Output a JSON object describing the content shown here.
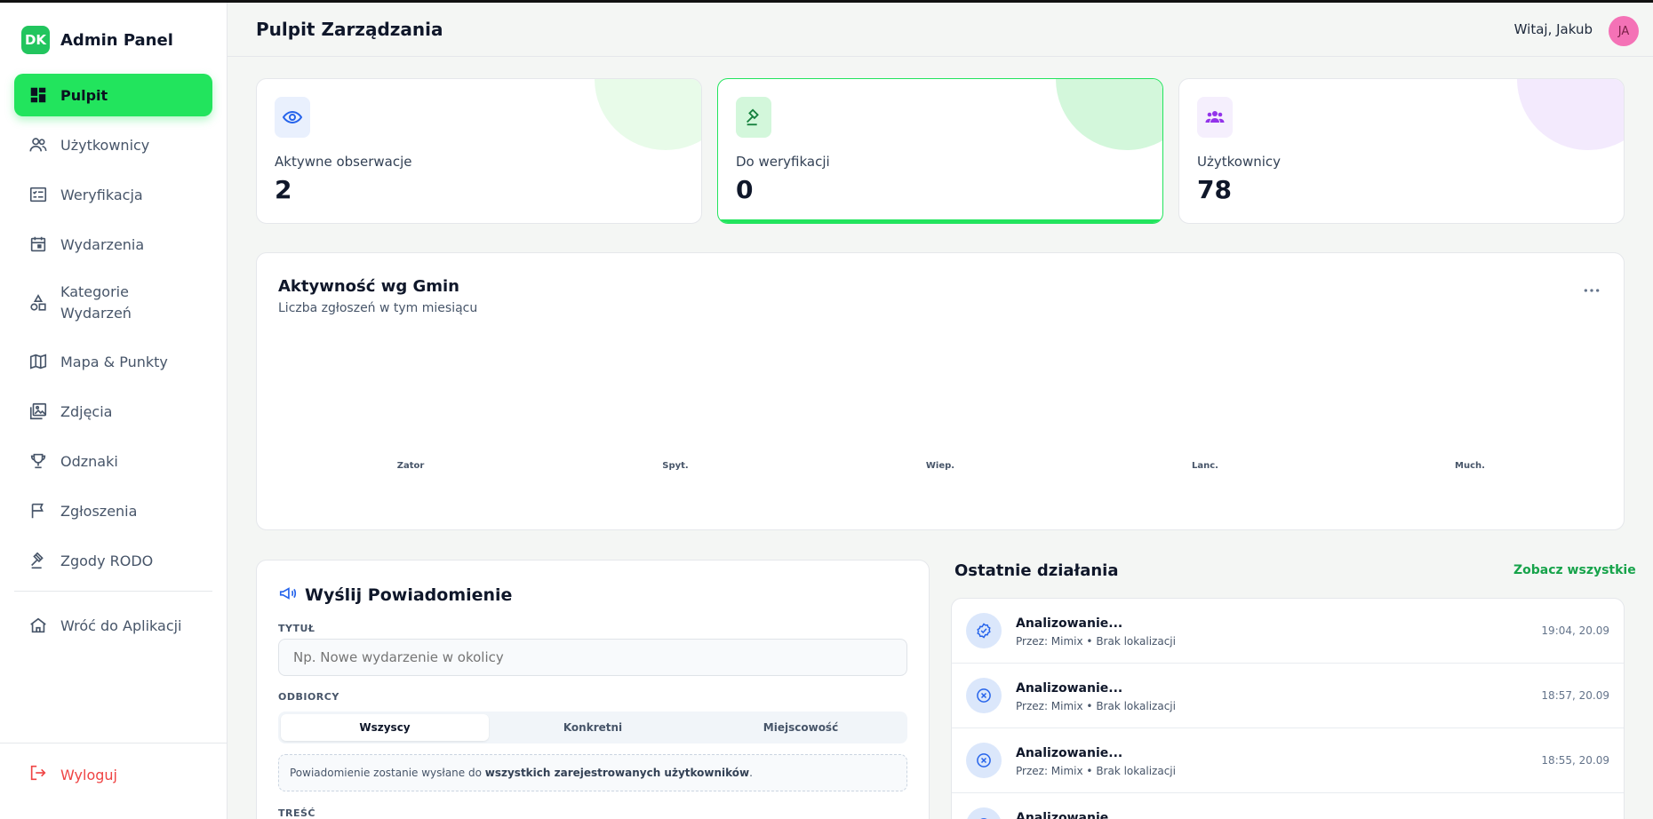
{
  "sidebar": {
    "brand_logo": "DK",
    "brand_title": "Admin Panel",
    "items": [
      {
        "label": "Pulpit",
        "icon": "dashboard-icon"
      },
      {
        "label": "Użytkownicy",
        "icon": "users-icon"
      },
      {
        "label": "Weryfikacja",
        "icon": "checklist-icon"
      },
      {
        "label": "Wydarzenia",
        "icon": "calendar-icon"
      },
      {
        "label": "Kategorie Wydarzeń",
        "label_line1": "Kategorie",
        "label_line2": "Wydarzeń",
        "icon": "shapes-icon"
      },
      {
        "label": "Mapa & Punkty",
        "icon": "map-icon"
      },
      {
        "label": "Zdjęcia",
        "icon": "photos-icon"
      },
      {
        "label": "Odznaki",
        "icon": "trophy-icon"
      },
      {
        "label": "Zgłoszenia",
        "icon": "flag-icon"
      },
      {
        "label": "Zgody RODO",
        "icon": "gavel-icon"
      },
      {
        "label": "Wróć do Aplikacji",
        "icon": "home-icon"
      }
    ],
    "logout_label": "Wyloguj"
  },
  "header": {
    "title": "Pulpit Zarządzania",
    "greeting": "Witaj, Jakub",
    "avatar_initials": "JA"
  },
  "stats": [
    {
      "label": "Aktywne obserwacje",
      "value": "2",
      "icon": "eye-icon",
      "accent": "#2563eb"
    },
    {
      "label": "Do weryfikacji",
      "value": "0",
      "icon": "gavel-icon",
      "accent": "#16a34a"
    },
    {
      "label": "Użytkownicy",
      "value": "78",
      "icon": "users-group-icon",
      "accent": "#9333ea"
    }
  ],
  "chart": {
    "title": "Aktywność wg Gmin",
    "subtitle": "Liczba zgłoszeń w tym miesiącu",
    "more_icon": "more-horizontal-icon"
  },
  "chart_data": {
    "type": "bar",
    "title": "Aktywność wg Gmin",
    "subtitle": "Liczba zgłoszeń w tym miesiącu",
    "categories": [
      "Zator",
      "Spyt.",
      "Wiep.",
      "Lanc.",
      "Much."
    ],
    "values": [
      0,
      0,
      0,
      0,
      0
    ],
    "xlabel": "",
    "ylabel": "",
    "grid": false
  },
  "notification": {
    "title": "Wyślij Powiadomienie",
    "icon": "megaphone-icon",
    "title_label": "TYTUŁ",
    "title_placeholder": "Np. Nowe wydarzenie w okolicy",
    "recipients_label": "ODBIORCY",
    "recipients": [
      "Wszyscy",
      "Konkretni",
      "Miejscowość"
    ],
    "recipients_selected": "Wszyscy",
    "info_prefix": "Powiadomienie zostanie wysłane do ",
    "info_bold": "wszystkich zarejestrowanych użytkowników",
    "info_suffix": ".",
    "content_label": "TREŚĆ"
  },
  "activity": {
    "title": "Ostatnie działania",
    "see_all": "Zobacz wszystkie",
    "items": [
      {
        "name": "Analizowanie...",
        "meta": "Przez: Mimix • Brak lokalizacji",
        "time": "19:04, 20.09",
        "icon": "check-badge-icon"
      },
      {
        "name": "Analizowanie...",
        "meta": "Przez: Mimix • Brak lokalizacji",
        "time": "18:57, 20.09",
        "icon": "x-circle-icon"
      },
      {
        "name": "Analizowanie...",
        "meta": "Przez: Mimix • Brak lokalizacji",
        "time": "18:55, 20.09",
        "icon": "x-circle-icon"
      },
      {
        "name": "Analizowanie...",
        "meta": "",
        "time": "",
        "icon": "x-circle-icon"
      }
    ]
  }
}
